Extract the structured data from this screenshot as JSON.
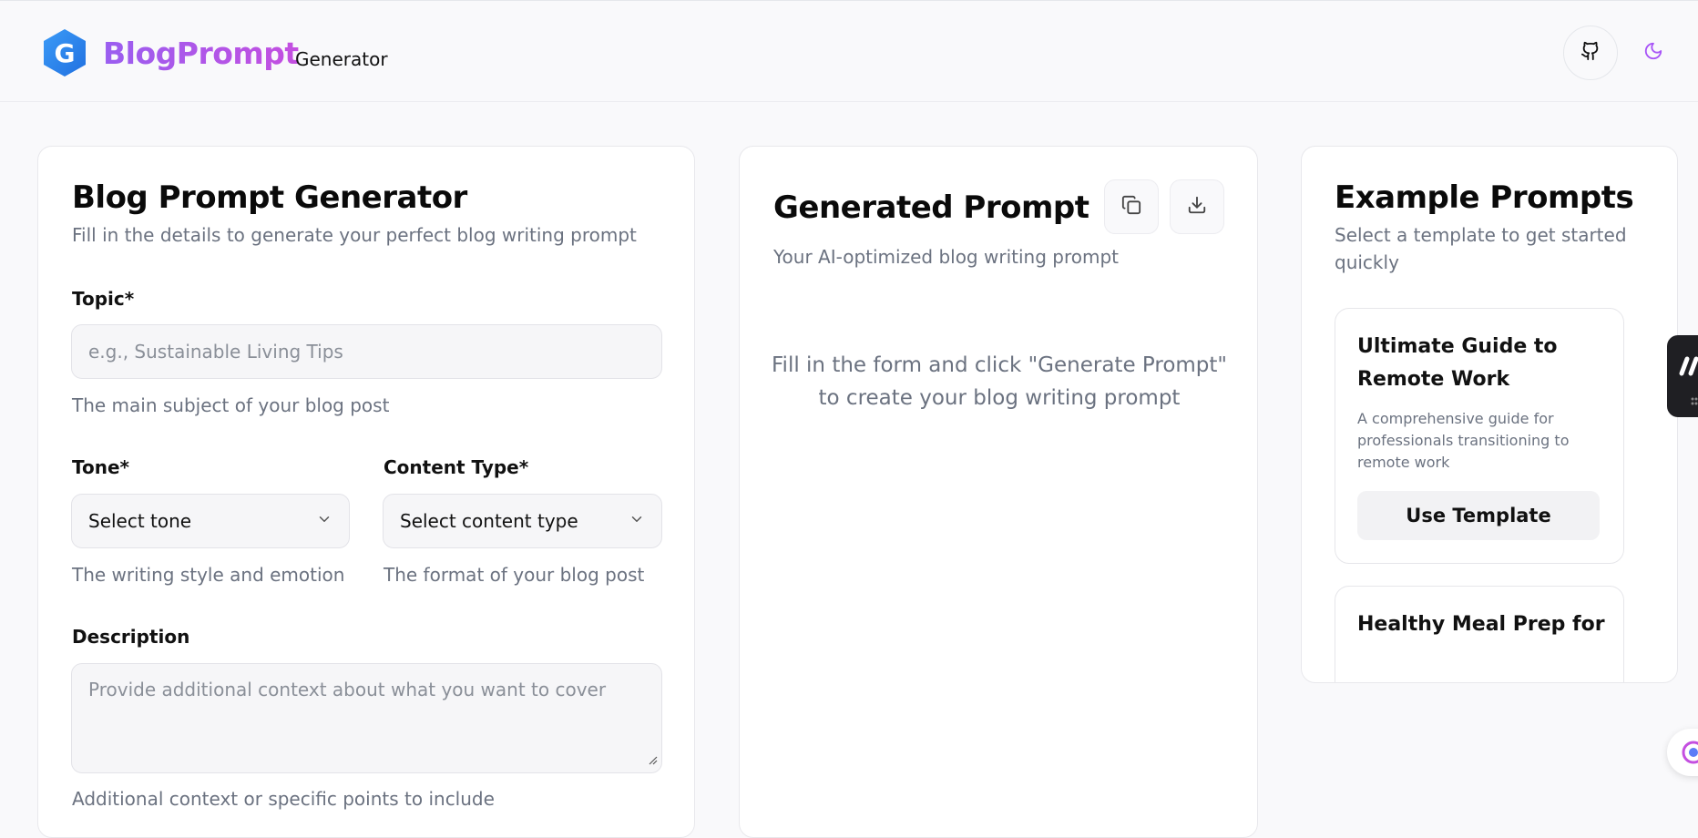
{
  "header": {
    "brand": "BlogPrompt",
    "brand_suffix": "Generator",
    "logo_letter": "G",
    "accent": "#a855f7",
    "logo_color": "#2f8af5",
    "github_icon": "github-icon",
    "theme_icon": "moon-icon"
  },
  "form": {
    "title": "Blog Prompt Generator",
    "subtitle": "Fill in the details to generate your perfect blog writing prompt",
    "topic": {
      "label": "Topic*",
      "placeholder": "e.g., Sustainable Living Tips",
      "help": "The main subject of your blog post"
    },
    "tone": {
      "label": "Tone*",
      "value": "Select tone",
      "help": "The writing style and emotion"
    },
    "content_type": {
      "label": "Content Type*",
      "value": "Select content type",
      "help": "The format of your blog post"
    },
    "description": {
      "label": "Description",
      "placeholder": "Provide additional context about what you want to cover",
      "help": "Additional context or specific points to include"
    }
  },
  "output": {
    "title": "Generated Prompt",
    "subtitle": "Your AI-optimized blog writing prompt",
    "empty_message": "Fill in the form and click \"Generate Prompt\" to create your blog writing prompt",
    "copy_icon": "copy-icon",
    "download_icon": "download-icon"
  },
  "examples": {
    "title": "Example Prompts",
    "subtitle": "Select a template to get started quickly",
    "templates": [
      {
        "title": "Ultimate Guide to Remote Work",
        "description": "A comprehensive guide for professionals transitioning to remote work",
        "button": "Use Template"
      },
      {
        "title": "Healthy Meal Prep for"
      }
    ]
  }
}
